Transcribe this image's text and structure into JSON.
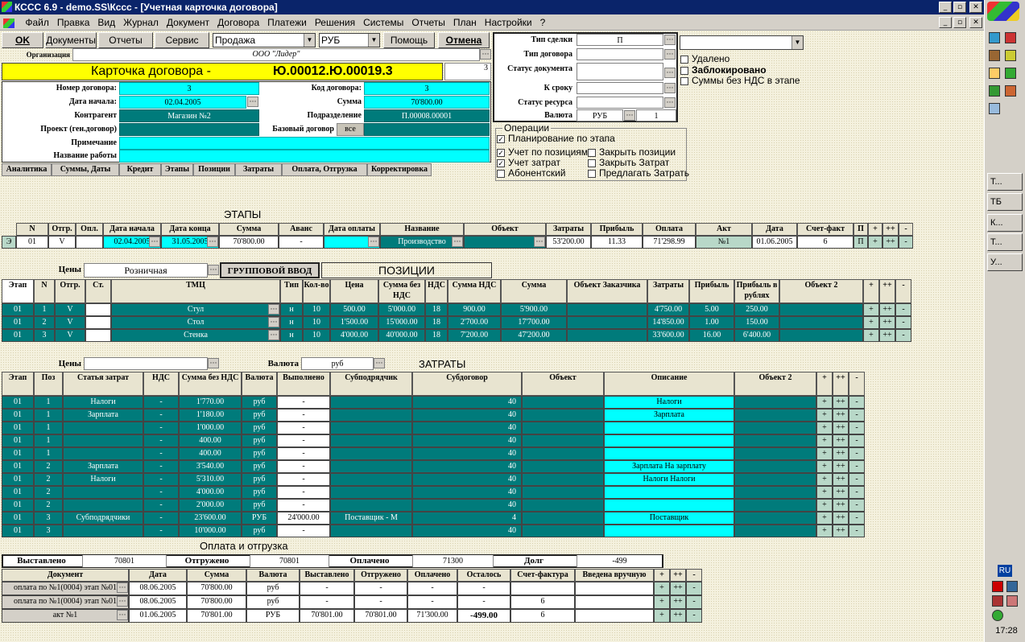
{
  "window": {
    "title": "КССС 6.9 - demo.SS\\Кссс - [Учетная карточка договора]",
    "min": "_",
    "max": "▫",
    "close": "✕"
  },
  "menu": [
    "Файл",
    "Правка",
    "Вид",
    "Журнал",
    "Документ",
    "Договора",
    "Платежи",
    "Решения",
    "Системы",
    "Отчеты",
    "План",
    "Настройки",
    "?"
  ],
  "toolbar": {
    "ok": "OK",
    "docs": "Документы",
    "reports": "Отчеты",
    "service": "Сервис",
    "mode": "Продажа",
    "currency": "РУБ",
    "help": "Помощь",
    "cancel": "Отмена"
  },
  "org": {
    "label": "Организация",
    "value": "ООО \"Лидер\""
  },
  "card": {
    "title": "Карточка договора -",
    "number": "Ю.00012.Ю.00019.3",
    "num_right": "3"
  },
  "fields": {
    "contract_no_l": "Номер договора:",
    "contract_no": "3",
    "code_l": "Код договора:",
    "code": "3",
    "start_l": "Дата начала:",
    "start": "02.04.2005",
    "sum_l": "Сумма",
    "sum": "70'800.00",
    "contractor_l": "Контрагент",
    "contractor": "Магазин №2",
    "div_l": "Подразделение",
    "div": "П.00008.00001",
    "project_l": "Проект (ген.договор)",
    "base_l": "Базовый договор",
    "base": "все",
    "note_l": "Примечание",
    "work_l": "Название работы"
  },
  "tabs": [
    "Аналитика",
    "Суммы, Даты",
    "Кредит",
    "Этапы",
    "Позиции",
    "Затраты",
    "Оплата, Отгрузка",
    "Корректировка"
  ],
  "right": {
    "deal_type_l": "Тип сделки",
    "deal_type": "П",
    "contract_type_l": "Тип договора",
    "doc_status_l": "Статус документа",
    "deadline_l": "К сроку",
    "res_status_l": "Статус ресурса",
    "currency_l": "Валюта",
    "currency": "РУБ",
    "rate": "1"
  },
  "flags": {
    "deleted": "Удалено",
    "blocked": "Заблокировано",
    "no_vat": "Суммы без НДС в этапе"
  },
  "ops": {
    "title": "Операции",
    "plan": "Планирование по этапа",
    "by_pos": "Учет по позициям",
    "cost": "Учет затрат",
    "subscr": "Абонентский",
    "close_pos": "Закрыть позиции",
    "close_cost": "Закрыть Затрат",
    "offer_cost": "Предлагать Затрать"
  },
  "stages": {
    "title": "ЭТАПЫ",
    "headers": [
      "N",
      "Отгр.",
      "Опл.",
      "Дата начала",
      "Дата конца",
      "Сумма",
      "Аванс",
      "Дата оплаты",
      "Название",
      "Объект",
      "Затраты",
      "Прибыль",
      "Оплата",
      "Акт",
      "Дата",
      "Счет-факт",
      "П",
      "+",
      "++",
      "-"
    ],
    "rows": [
      [
        "Э",
        "01",
        "V",
        "",
        "02.04.2005",
        "31.05.2005",
        "70'800.00",
        "-",
        "",
        "Производство",
        "",
        "53'200.00",
        "11.33",
        "71'298.99",
        "№1",
        "01.06.2005",
        "6",
        "П",
        "+",
        "++",
        "-"
      ]
    ]
  },
  "positions": {
    "title": "ПОЗИЦИИ",
    "prices_l": "Цены",
    "prices": "Розничная",
    "group": "ГРУППОВОЙ ВВОД",
    "headers": [
      "Этап",
      "N",
      "Отгр.",
      "Ст.",
      "ТМЦ",
      "Тип",
      "Кол-во",
      "Цена",
      "Сумма без НДС",
      "НДС",
      "Сумма НДС",
      "Сумма",
      "Объект Заказчика",
      "Затраты",
      "Прибыль",
      "Прибыль в рублях",
      "Объект 2",
      "+",
      "++",
      "-"
    ],
    "rows": [
      [
        "01",
        "1",
        "V",
        "",
        "Стул",
        "н",
        "10",
        "500.00",
        "5'000.00",
        "18",
        "900.00",
        "5'900.00",
        "",
        "4'750.00",
        "5.00",
        "250.00"
      ],
      [
        "01",
        "2",
        "V",
        "",
        "Стол",
        "н",
        "10",
        "1'500.00",
        "15'000.00",
        "18",
        "2'700.00",
        "17'700.00",
        "",
        "14'850.00",
        "1.00",
        "150.00"
      ],
      [
        "01",
        "3",
        "V",
        "",
        "Стенка",
        "н",
        "10",
        "4'000.00",
        "40'000.00",
        "18",
        "7'200.00",
        "47'200.00",
        "",
        "33'600.00",
        "16.00",
        "6'400.00"
      ]
    ]
  },
  "costs": {
    "title": "ЗАТРАТЫ",
    "prices_l": "Цены",
    "currency_l": "Валюта",
    "currency": "руб",
    "headers": [
      "Этап",
      "Поз",
      "Статья затрат",
      "НДС",
      "Сумма без НДС",
      "Валюта",
      "Выполнено",
      "Субподрядчик",
      "Субдоговор",
      "Объект",
      "Описание",
      "Объект 2",
      "+",
      "++",
      "-"
    ],
    "rows": [
      [
        "01",
        "1",
        "Налоги",
        "-",
        "1'770.00",
        "руб",
        "-",
        "",
        "40",
        "",
        "Налоги"
      ],
      [
        "01",
        "1",
        "Зарплата",
        "-",
        "1'180.00",
        "руб",
        "-",
        "",
        "40",
        "",
        "Зарплата"
      ],
      [
        "01",
        "1",
        "",
        "-",
        "1'000.00",
        "руб",
        "-",
        "",
        "40",
        "",
        ""
      ],
      [
        "01",
        "1",
        "",
        "-",
        "400.00",
        "руб",
        "-",
        "",
        "40",
        "",
        ""
      ],
      [
        "01",
        "1",
        "",
        "-",
        "400.00",
        "руб",
        "-",
        "",
        "40",
        "",
        ""
      ],
      [
        "01",
        "2",
        "Зарплата",
        "-",
        "3'540.00",
        "руб",
        "-",
        "",
        "40",
        "",
        "Зарплата На зарплату"
      ],
      [
        "01",
        "2",
        "Налоги",
        "-",
        "5'310.00",
        "руб",
        "-",
        "",
        "40",
        "",
        "Налоги Налоги"
      ],
      [
        "01",
        "2",
        "",
        "-",
        "4'000.00",
        "руб",
        "-",
        "",
        "40",
        "",
        ""
      ],
      [
        "01",
        "2",
        "",
        "-",
        "2'000.00",
        "руб",
        "-",
        "",
        "40",
        "",
        ""
      ],
      [
        "01",
        "3",
        "Субподрядчики",
        "-",
        "23'600.00",
        "РУБ",
        "24'000.00",
        "Поставщик - М",
        "4",
        "",
        "Поставщик"
      ],
      [
        "01",
        "3",
        "",
        "-",
        "10'000.00",
        "руб",
        "-",
        "",
        "40",
        "",
        ""
      ]
    ]
  },
  "payment": {
    "title": "Оплата и отгрузка",
    "issued_l": "Выставлено",
    "issued": "70801",
    "shipped_l": "Отгружено",
    "shipped": "70801",
    "paid_l": "Оплачено",
    "paid": "71300",
    "debt_l": "Долг",
    "debt": "-499",
    "headers": [
      "Документ",
      "Дата",
      "Сумма",
      "Валюта",
      "Выставлено",
      "Отгружено",
      "Оплачено",
      "Осталось",
      "Счет-фактура",
      "Введена вручную",
      "+",
      "++",
      "-"
    ],
    "rows": [
      [
        "оплата по №1(0004) этап №01",
        "08.06.2005",
        "70'800.00",
        "руб",
        "-",
        "-",
        "-",
        "-",
        ""
      ],
      [
        "оплата по №1(0004) этап №01",
        "08.06.2005",
        "70'800.00",
        "руб",
        "-",
        "-",
        "-",
        "-",
        "6"
      ],
      [
        "акт №1",
        "01.06.2005",
        "70'801.00",
        "РУБ",
        "70'801.00",
        "70'801.00",
        "71'300.00",
        "-499.00",
        "6"
      ]
    ]
  },
  "taskbar": {
    "items": [
      "Т...",
      "ТБ",
      "К...",
      "Т...",
      "У..."
    ],
    "lang": "RU",
    "clock": "17:28"
  }
}
